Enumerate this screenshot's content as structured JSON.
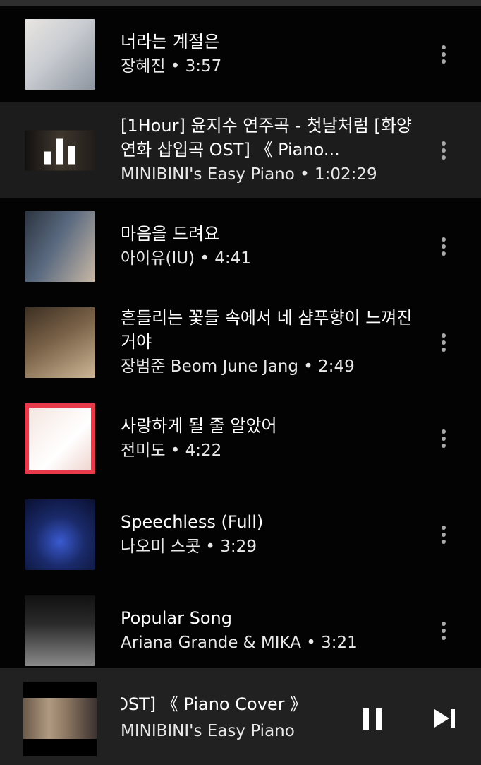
{
  "tracks": [
    {
      "title": "너라는 계절은",
      "subtitle": "장혜진 • 3:57",
      "active": false,
      "thumb": {
        "colors": [
          "#c9ccd1",
          "#8d95a0",
          "#e9e6e2"
        ]
      }
    },
    {
      "title": "[1Hour] 윤지수 연주곡 - 첫날처럼 [화양연화 삽입곡 OST] 《 Piano...",
      "subtitle": "MINIBINI's Easy Piano • 1:02:29",
      "active": true,
      "thumb": {
        "colors": [
          "#4a4038",
          "#8a7a66",
          "#2a2622"
        ]
      }
    },
    {
      "title": "마음을 드려요",
      "subtitle": "아이유(IU) • 4:41",
      "active": false,
      "thumb": {
        "colors": [
          "#5a6a80",
          "#c9b8a6",
          "#2c3440"
        ]
      }
    },
    {
      "title": "흔들리는 꽃들 속에서 네 샴푸향이 느껴진거야",
      "subtitle": "장범준 Beom June Jang • 2:49",
      "active": false,
      "thumb": {
        "colors": [
          "#7a6248",
          "#cdb596",
          "#3c2f22"
        ]
      }
    },
    {
      "title": "사랑하게 될 줄 알았어",
      "subtitle": "전미도 • 4:22",
      "active": false,
      "thumb": {
        "colors": [
          "#e83a4a",
          "#f4e6e0",
          "#b5202c"
        ]
      }
    },
    {
      "title": "Speechless (Full)",
      "subtitle": "나오미 스콧 • 3:29",
      "active": false,
      "thumb": {
        "colors": [
          "#1a2a6a",
          "#3a5ad0",
          "#0a1030"
        ]
      }
    },
    {
      "title": "Popular Song",
      "subtitle": "Ariana Grande & MIKA • 3:21",
      "active": false,
      "thumb": {
        "colors": [
          "#2a2a2a",
          "#8a8a8a",
          "#111111"
        ]
      }
    }
  ],
  "now_playing": {
    "title": "OST] 《 Piano Cover 》",
    "subtitle": "MINIBINI's Easy Piano"
  },
  "icons": {
    "more": "more-vertical-icon",
    "pause": "pause-icon",
    "next": "skip-next-icon",
    "playing": "equalizer-bars-icon"
  },
  "colors": {
    "background": "#030303",
    "active_row": "#1c1c1c",
    "player_bar": "#212121",
    "text": "#ffffff",
    "menu_dots": "#a8a8a8"
  }
}
